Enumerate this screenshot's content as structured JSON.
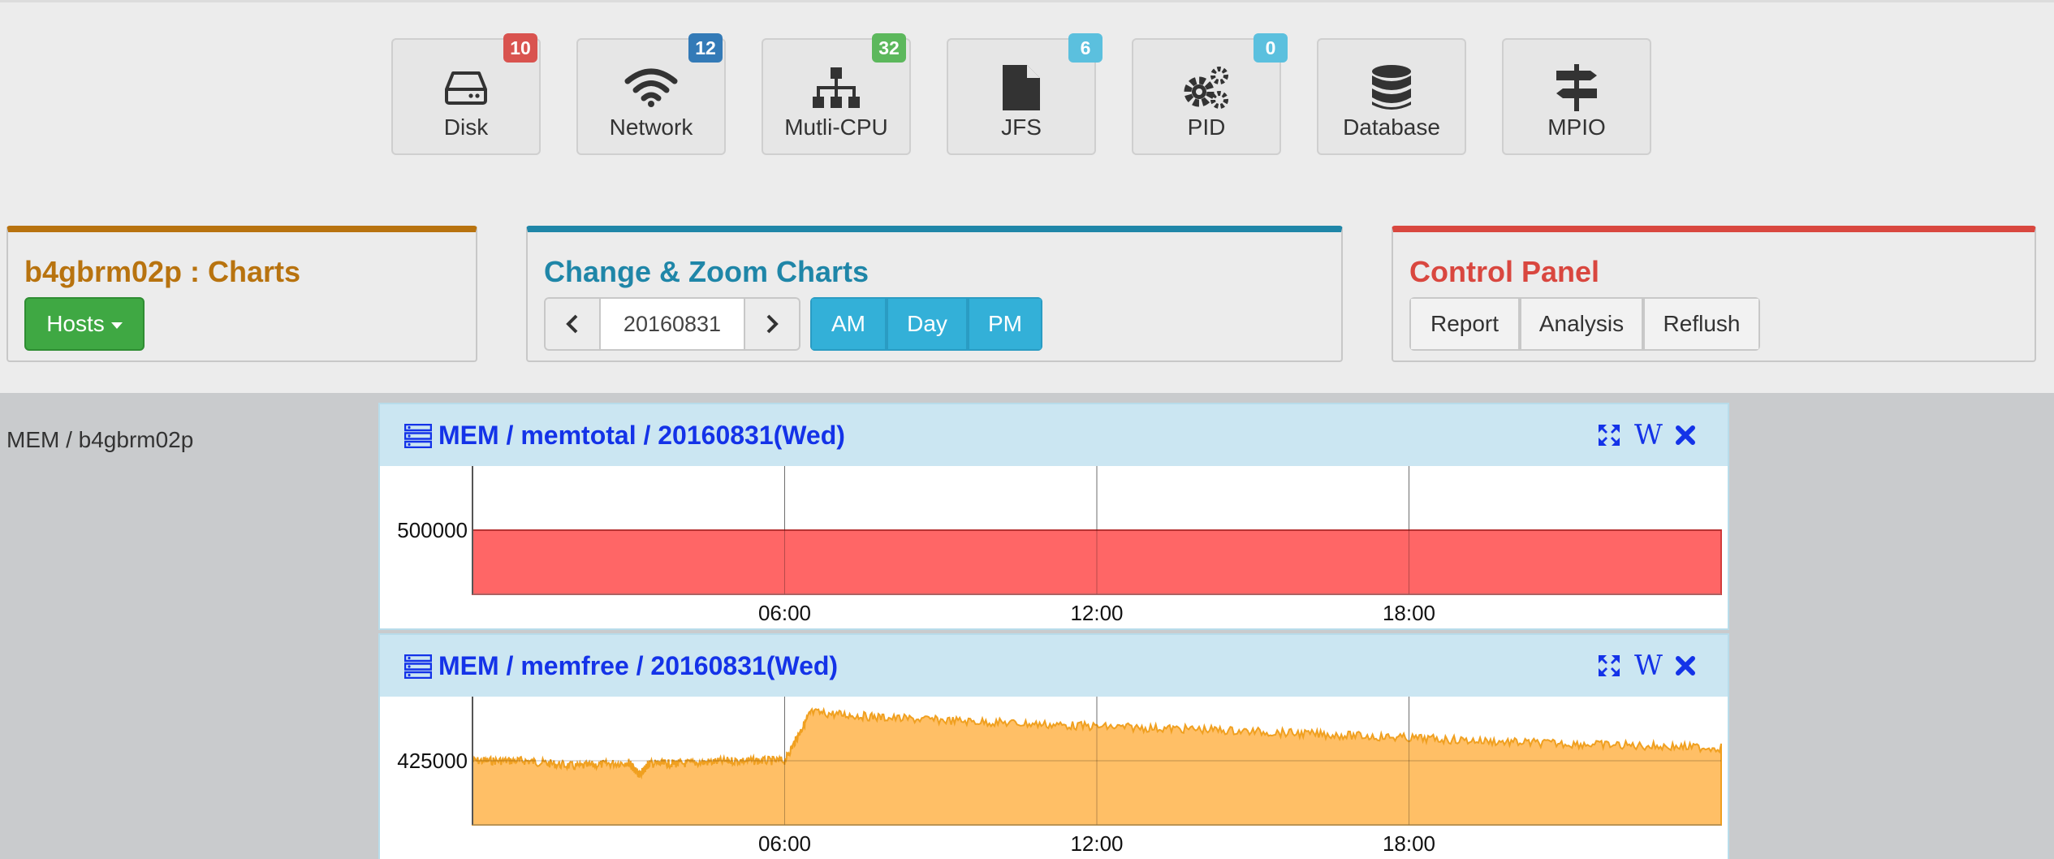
{
  "nav": [
    {
      "label": "Disk",
      "badge": "10",
      "badge_color": "#d9534f",
      "icon": "hard-drive-icon"
    },
    {
      "label": "Network",
      "badge": "12",
      "badge_color": "#337ab7",
      "icon": "wifi-icon"
    },
    {
      "label": "Mutli-CPU",
      "badge": "32",
      "badge_color": "#5cb85c",
      "icon": "sitemap-icon"
    },
    {
      "label": "JFS",
      "badge": "6",
      "badge_color": "#5bc0de",
      "icon": "file-icon"
    },
    {
      "label": "PID",
      "badge": "0",
      "badge_color": "#5bc0de",
      "icon": "gears-icon"
    },
    {
      "label": "Database",
      "badge": "",
      "badge_color": "",
      "icon": "database-icon"
    },
    {
      "label": "MPIO",
      "badge": "",
      "badge_color": "",
      "icon": "signpost-icon"
    }
  ],
  "host_panel": {
    "title": "b4gbrm02p : Charts",
    "hosts_button": "Hosts",
    "accent": "#b8730f"
  },
  "zoom_panel": {
    "title": "Change & Zoom Charts",
    "date_value": "20160831",
    "am": "AM",
    "day": "Day",
    "pm": "PM",
    "accent": "#1f86a8"
  },
  "control_panel": {
    "title": "Control Panel",
    "report": "Report",
    "analysis": "Analysis",
    "reflush": "Reflush",
    "accent": "#d9473f"
  },
  "side_label": "MEM / b4gbrm02p",
  "chart_data": [
    {
      "type": "area",
      "title": "MEM / memtotal / 20160831(Wed)",
      "x_ticks": [
        "06:00",
        "12:00",
        "18:00"
      ],
      "xlim_hours": [
        0,
        24
      ],
      "y_tick": "500000",
      "y_tick_value": 500000,
      "ylim": [
        450000,
        550000
      ],
      "series": [
        {
          "color": "#ff6666",
          "x_hours": [
            0,
            24
          ],
          "y": [
            500000,
            500000
          ]
        }
      ]
    },
    {
      "type": "area",
      "title": "MEM / memfree / 20160831(Wed)",
      "x_ticks": [
        "06:00",
        "12:00",
        "18:00"
      ],
      "xlim_hours": [
        0,
        24
      ],
      "y_tick": "425000",
      "y_tick_value": 425000,
      "ylim": [
        380000,
        470000
      ],
      "series": [
        {
          "color": "#ffbf66",
          "x_hours": [
            0,
            1,
            2,
            3,
            3.2,
            3.4,
            4,
            5,
            6,
            6.5,
            8,
            10,
            12,
            14,
            16,
            18,
            20,
            22,
            24
          ],
          "y": [
            428000,
            428000,
            424000,
            427000,
            418000,
            426000,
            426000,
            428000,
            428000,
            462000,
            458000,
            455000,
            452000,
            450000,
            447000,
            444000,
            441000,
            439000,
            437000
          ]
        }
      ]
    }
  ]
}
